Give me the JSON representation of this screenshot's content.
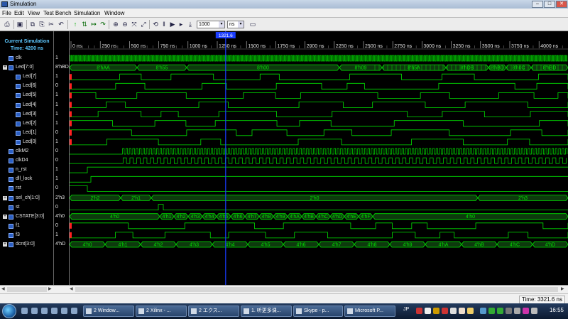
{
  "window": {
    "title": "Simulation",
    "min": "–",
    "max": "□",
    "close": "✕"
  },
  "menu": [
    "File",
    "Edit",
    "View",
    "Test Bench",
    "Simulation",
    "Window"
  ],
  "toolbar": {
    "icons": [
      "print-icon",
      "save-icon",
      "copy-icon",
      "paste-icon",
      "cut-icon",
      "undo-icon",
      "markers-icon",
      "waveform-add-icon",
      "step-icon",
      "run-icon",
      "zoom-in-icon",
      "zoom-out-icon",
      "zoom-fit-icon",
      "zoom-full-icon",
      "restart-icon",
      "pause-icon",
      "run-for-icon",
      "run-all-icon",
      "goto-icon"
    ],
    "time_value": "1000",
    "time_unit": "ns"
  },
  "current_simulation": {
    "label": "Current Simulation",
    "time": "Time: 4200 ns"
  },
  "cursor": {
    "label": "1321.6",
    "time_ns": 1321.6
  },
  "timeline": {
    "ticks": [
      "0 ns",
      "250 ns",
      "500 ns",
      "750 ns",
      "1000 ns",
      "1250 ns",
      "1500 ns",
      "1750 ns",
      "2000 ns",
      "2250 ns",
      "2500 ns",
      "2750 ns",
      "3000 ns",
      "3250 ns",
      "3500 ns",
      "3750 ns",
      "4000 ns"
    ],
    "tick_step_ns": 250
  },
  "signals": [
    {
      "name": "clk",
      "value": "1",
      "kind": "clock",
      "expand": ""
    },
    {
      "name": "Led[7:0]",
      "value": "8'hBD",
      "kind": "bus",
      "expand": "+",
      "segments": [
        "8'hAA",
        "8'h55",
        "8'h00",
        "8'h09",
        "8'h5A",
        "8'hDB",
        "8'hBD",
        "8'h0C",
        "8'hBD"
      ]
    },
    {
      "name": "Led[7]",
      "value": "1",
      "kind": "bit"
    },
    {
      "name": "Led[6]",
      "value": "0",
      "kind": "bit"
    },
    {
      "name": "Led[5]",
      "value": "1",
      "kind": "bit"
    },
    {
      "name": "Led[4]",
      "value": "1",
      "kind": "bit"
    },
    {
      "name": "Led[3]",
      "value": "1",
      "kind": "bit"
    },
    {
      "name": "Led[2]",
      "value": "1",
      "kind": "bit"
    },
    {
      "name": "Led[1]",
      "value": "0",
      "kind": "bit"
    },
    {
      "name": "Led[0]",
      "value": "1",
      "kind": "bit"
    },
    {
      "name": "clkM2",
      "value": "0",
      "kind": "clock"
    },
    {
      "name": "clkD4",
      "value": "0",
      "kind": "clock"
    },
    {
      "name": "n_rst",
      "value": "1",
      "kind": "bit"
    },
    {
      "name": "dll_lock",
      "value": "1",
      "kind": "bit"
    },
    {
      "name": "rst",
      "value": "0",
      "kind": "bit"
    },
    {
      "name": "sel_ch[1:0]",
      "value": "2'h3",
      "kind": "bus",
      "expand": "+",
      "segments": [
        "2'h2",
        "2'h1",
        "2'h0",
        "2'h3"
      ]
    },
    {
      "name": "st",
      "value": "0",
      "kind": "bit"
    },
    {
      "name": "CSTATE[3:0]",
      "value": "4'h0",
      "kind": "bus",
      "expand": "+",
      "segments": [
        "4'h0",
        "4'h1",
        "4'h2",
        "4'h3",
        "4'h4",
        "4'h5",
        "4'h6",
        "4'h7",
        "4'h8",
        "4'h9",
        "4'hA",
        "4'hB",
        "4'hC",
        "4'hD",
        "4'hE",
        "4'hF",
        "4'h0"
      ]
    },
    {
      "name": "f1",
      "value": "0",
      "kind": "bit"
    },
    {
      "name": "f3",
      "value": "1",
      "kind": "bit"
    },
    {
      "name": "dcnt[3:0]",
      "value": "4'hD",
      "kind": "bus",
      "expand": "+",
      "segments": [
        "4'h0",
        "4'h1",
        "4'h2",
        "4'h3",
        "4'h4",
        "4'h5",
        "4'h6",
        "4'h7",
        "4'h8",
        "4'h9",
        "4'hA",
        "4'hB",
        "4'hC",
        "4'hD"
      ]
    }
  ],
  "status": {
    "time": "Time: 3321.6 ns"
  },
  "taskbar": {
    "buttons": [
      "2 Window...",
      "2 Xilinx - ...",
      "2 エクス...",
      "1. 听更多课...",
      "Skype - p...",
      "Microsoft P..."
    ],
    "lang": "JP",
    "clock": "16:55"
  },
  "colors": {
    "wave": "#00e000",
    "cursor": "#1a3cff",
    "unknown": "#ff2020",
    "bus_fill": "#0d3a0d"
  }
}
